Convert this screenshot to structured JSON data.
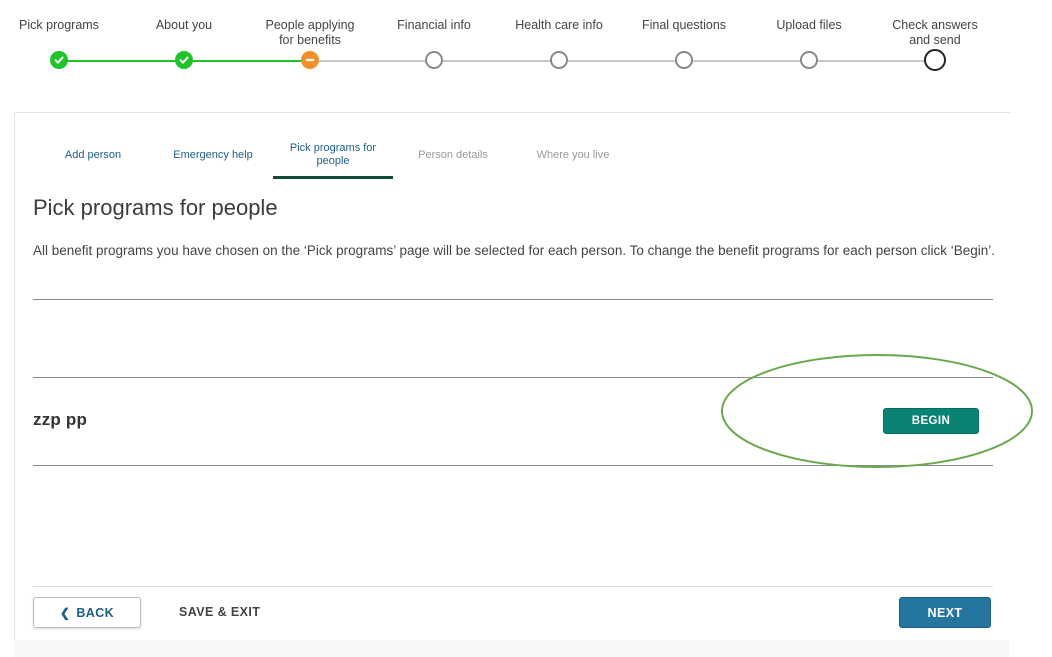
{
  "stepper": {
    "steps": [
      {
        "label": "Pick programs",
        "status": "done"
      },
      {
        "label": "About you",
        "status": "done"
      },
      {
        "label": "People applying\nfor benefits",
        "status": "current"
      },
      {
        "label": "Financial info",
        "status": "todo"
      },
      {
        "label": "Health care info",
        "status": "todo"
      },
      {
        "label": "Final questions",
        "status": "todo"
      },
      {
        "label": "Upload files",
        "status": "todo"
      },
      {
        "label": "Check answers\nand send",
        "status": "todo"
      }
    ],
    "colors": {
      "done": "#1fc32a",
      "current": "#f28f2b",
      "todo": "#888888"
    }
  },
  "subtabs": [
    {
      "label": "Add person",
      "state": "enabled"
    },
    {
      "label": "Emergency help",
      "state": "enabled"
    },
    {
      "label": "Pick programs for\npeople",
      "state": "active"
    },
    {
      "label": "Person details",
      "state": "disabled"
    },
    {
      "label": "Where you live",
      "state": "disabled"
    }
  ],
  "main": {
    "title": "Pick programs for people",
    "intro": "All benefit programs you have chosen on the ‘Pick programs’ page will be selected for each person. To change the benefit programs for each person click ‘Begin’.",
    "people": [
      {
        "name": "zzp pp",
        "action_label": "BEGIN"
      }
    ]
  },
  "footer": {
    "back_label": "BACK",
    "save_exit_label": "SAVE & EXIT",
    "next_label": "NEXT"
  },
  "colors": {
    "begin_button": "#0a8274",
    "next_button": "#24759f",
    "active_tab_underline": "#114a3a",
    "annotation_ellipse": "#6aa84f"
  }
}
